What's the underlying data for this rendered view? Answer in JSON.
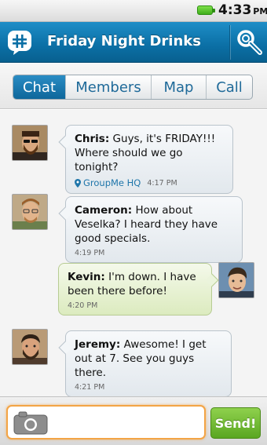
{
  "status_bar": {
    "time": "4:33",
    "ampm": "PM",
    "battery_color": "#5cc52b"
  },
  "header": {
    "title": "Friday Night Drinks",
    "accent": "#0b6fa5",
    "app_icon": "groupme-hash-icon",
    "settings_icon": "wrench-search-icon"
  },
  "tabs": [
    {
      "label": "Chat",
      "active": true
    },
    {
      "label": "Members",
      "active": false
    },
    {
      "label": "Map",
      "active": false
    },
    {
      "label": "Call",
      "active": false
    }
  ],
  "messages": [
    {
      "sender": "Chris:",
      "text": "Guys, it's FRIDAY!!! Where should we go tonight?",
      "location": "GroupMe HQ",
      "time": "4:17 PM",
      "mine": false
    },
    {
      "sender": "Cameron:",
      "text": "How about Veselka? I heard they have good specials.",
      "time": "4:19 PM",
      "mine": false
    },
    {
      "sender": "Kevin:",
      "text": "I'm down. I have been there before!",
      "time": "4:20 PM",
      "mine": true
    },
    {
      "sender": "Jeremy:",
      "text": "Awesome! I get out at 7. See you guys there.",
      "time": "4:21 PM",
      "mine": false
    }
  ],
  "composer": {
    "placeholder": "",
    "send_label": "Send!",
    "camera_icon": "camera-icon"
  }
}
